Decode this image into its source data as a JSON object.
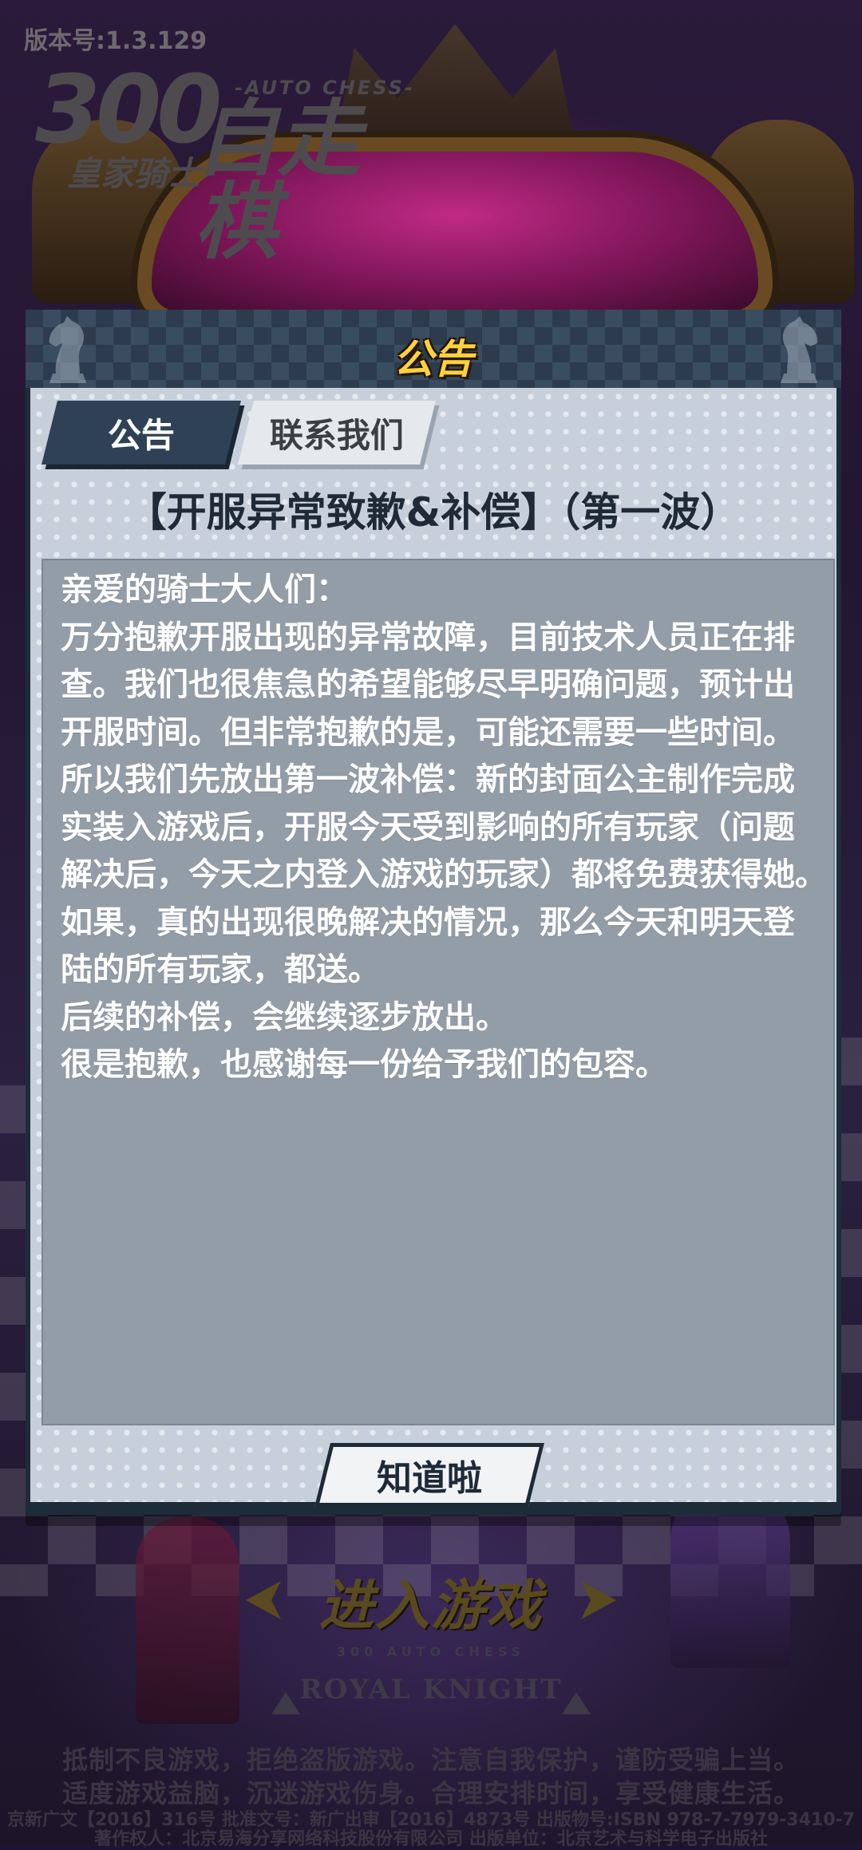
{
  "version": "版本号:1.3.129",
  "logo": {
    "number": "300",
    "subtitle": "皇家骑士",
    "tagline": "-AUTO CHESS-",
    "name": "自走棋"
  },
  "modal": {
    "header_title": "公告",
    "tabs": [
      {
        "label": "公告",
        "active": true
      },
      {
        "label": "联系我们",
        "active": false
      }
    ],
    "notice_title": "【开服异常致歉&补偿】（第一波）",
    "body_lines": [
      "亲爱的骑士大人们：",
      "万分抱歉开服出现的异常故障，目前技术人员正在排",
      "查。我们也很焦急的希望能够尽早明确问题，预计出",
      "开服时间。但非常抱歉的是，可能还需要一些时间。",
      "所以我们先放出第一波补偿：新的封面公主制作完成",
      "实装入游戏后，开服今天受到影响的所有玩家（问题",
      "解决后，今天之内登入游戏的玩家）都将免费获得她。",
      "如果，真的出现很晚解决的情况，那么今天和明天登",
      "陆的所有玩家，都送。",
      "后续的补偿，会继续逐步放出。",
      "很是抱歉，也感谢每一份给予我们的包容。"
    ],
    "ok_button": "知道啦"
  },
  "enter_game": "进入游戏",
  "emblem": {
    "small": "300 AUTO CHESS",
    "big": "ROYAL KNIGHT"
  },
  "advice": [
    "抵制不良游戏，拒绝盗版游戏。注意自我保护，谨防受骗上当。",
    "适度游戏益脑，沉迷游戏伤身。合理安排时间，享受健康生活。"
  ],
  "license": [
    "京新广文【2016】316号 批准文号：新广出审【2016】4873号 出版物号:ISBN 978-7-7979-3410-7",
    "著作权人：北京易海分享网络科技股份有限公司 出版单位：北京艺术与科学电子出版社"
  ],
  "colors": {
    "title_gold": "#ffd23c",
    "tab_active": "#2e4156",
    "content_box": "#939da8"
  }
}
